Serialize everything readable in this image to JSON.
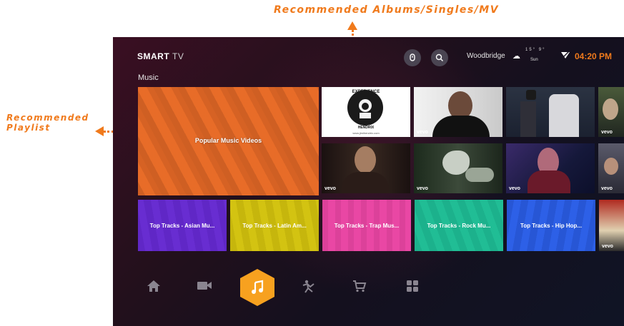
{
  "annotations": {
    "top": "Recommended Albums/Singles/MV",
    "left_line1": "Recommended",
    "left_line2": "Playlist"
  },
  "header": {
    "logo_brand": "SMART",
    "logo_suffix": "TV",
    "location": "Woodbridge",
    "temperature": "15°  9°",
    "day": "Sun",
    "time": "04:20 PM",
    "icons": [
      "input-source-icon",
      "search-icon",
      "cloud-icon",
      "wifi-icon"
    ]
  },
  "section_title": "Music",
  "featured": {
    "label": "Popular Music Videos"
  },
  "album": {
    "top_text": "EXPERIENCE",
    "bottom_text": "HENDRIX",
    "url": "www.jimihendrix.com"
  },
  "video_badge": "vevo",
  "genres": [
    {
      "label": "Top Tracks - Asian Mu...",
      "color": "#6a2bd8"
    },
    {
      "label": "Top Tracks - Latin Am...",
      "color": "#d9c80c"
    },
    {
      "label": "Top Tracks - Trap Mus...",
      "color": "#f048a8"
    },
    {
      "label": "Top Tracks - Rock Mu...",
      "color": "#1fc39a"
    },
    {
      "label": "Top Tracks - Hip Hop...",
      "color": "#2b5ee8"
    }
  ],
  "nav": [
    "home-icon",
    "video-icon",
    "music-icon",
    "sports-icon",
    "shop-icon",
    "apps-icon"
  ],
  "colors": {
    "accent": "#f07a1c",
    "nav_active": "#f7a11f"
  }
}
